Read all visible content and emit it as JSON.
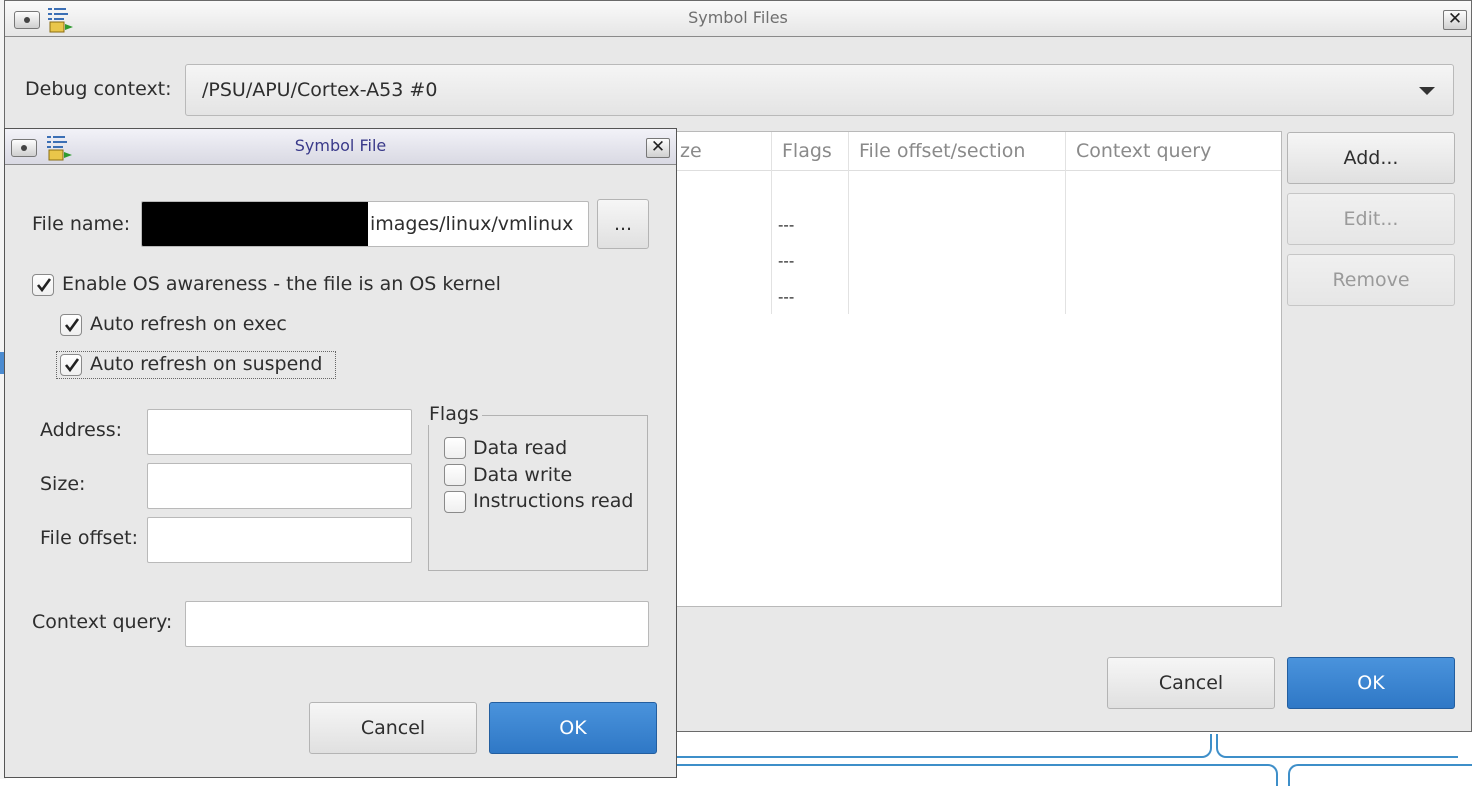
{
  "outer_dialog": {
    "title": "Symbol Files",
    "close_glyph": "✕",
    "debug_context_label": "Debug context:",
    "debug_context_value": "/PSU/APU/Cortex-A53 #0",
    "table": {
      "columns": [
        "ze",
        "Flags",
        "File offset/section",
        "Context query"
      ],
      "flags_cells": [
        "---",
        "---",
        "---"
      ]
    },
    "add_label": "Add...",
    "edit_label": "Edit...",
    "remove_label": "Remove",
    "cancel_label": "Cancel",
    "ok_label": "OK"
  },
  "inner_dialog": {
    "title": "Symbol File",
    "close_glyph": "✕",
    "file_name_label": "File name:",
    "file_name_value": "images/linux/vmlinux",
    "browse_label": "...",
    "os_awareness": {
      "label": "Enable OS awareness - the file is an OS kernel",
      "checked": true
    },
    "auto_refresh_exec": {
      "label": "Auto refresh on exec",
      "checked": true
    },
    "auto_refresh_suspend": {
      "label": "Auto refresh on suspend",
      "checked": true
    },
    "address_label": "Address:",
    "address_value": "",
    "size_label": "Size:",
    "size_value": "",
    "file_offset_label": "File offset:",
    "file_offset_value": "",
    "flags": {
      "legend": "Flags",
      "items": [
        {
          "label": "Data read",
          "checked": false
        },
        {
          "label": "Data write",
          "checked": false
        },
        {
          "label": "Instructions read",
          "checked": false
        }
      ]
    },
    "context_query_label": "Context query:",
    "context_query_value": "",
    "cancel_label": "Cancel",
    "ok_label": "OK"
  },
  "colors": {
    "primary_button": "#2f78c6",
    "inner_title_text": "#3a3a8a",
    "background_link_lines": "#3e8fc9"
  }
}
